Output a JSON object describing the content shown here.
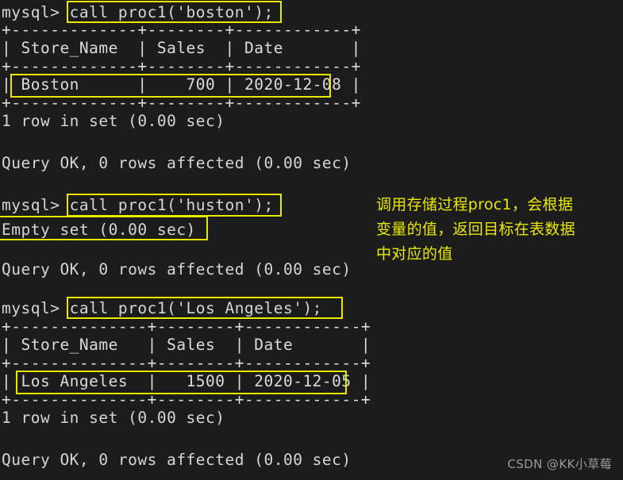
{
  "terminal": {
    "background_color": "#1c1c1c",
    "text_color": "#d6d6d6",
    "highlight_color": "#e9e900",
    "prompt": "mysql>",
    "lines": [
      {
        "text": "mysql> call proc1('boston');"
      },
      {
        "text": "+-------------+--------+------------+"
      },
      {
        "text": "| Store_Name  | Sales  | Date       |"
      },
      {
        "text": "+-------------+--------+------------+"
      },
      {
        "text": "| Boston      |    700 | 2020-12-08 |"
      },
      {
        "text": "+-------------+--------+------------+"
      },
      {
        "text": "1 row in set (0.00 sec)"
      },
      {
        "text": ""
      },
      {
        "text": "Query OK, 0 rows affected (0.00 sec)"
      },
      {
        "text": ""
      },
      {
        "text": "mysql> call proc1('huston');"
      },
      {
        "text": "Empty set (0.00 sec)"
      },
      {
        "text": ""
      },
      {
        "text": "Query OK, 0 rows affected (0.00 sec)"
      },
      {
        "text": ""
      },
      {
        "text": "mysql> call proc1('Los Angeles');"
      },
      {
        "text": "+--------------+--------+------------+"
      },
      {
        "text": "| Store_Name   | Sales  | Date       |"
      },
      {
        "text": "+--------------+--------+------------+"
      },
      {
        "text": "| Los Angeles  |   1500 | 2020-12-05 |"
      },
      {
        "text": "+--------------+--------+------------+"
      },
      {
        "text": "1 row in set (0.00 sec)"
      },
      {
        "text": ""
      },
      {
        "text": "Query OK, 0 rows affected (0.00 sec)"
      }
    ],
    "commands": [
      "call proc1('boston');",
      "call proc1('huston');",
      "call proc1('Los Angeles');"
    ],
    "result_sets": [
      {
        "columns": [
          "Store_Name",
          "Sales",
          "Date"
        ],
        "rows": [
          [
            "Boston",
            "700",
            "2020-12-08"
          ]
        ],
        "status": "1 row in set (0.00 sec)"
      },
      {
        "columns": [],
        "rows": [],
        "status": "Empty set (0.00 sec)"
      },
      {
        "columns": [
          "Store_Name",
          "Sales",
          "Date"
        ],
        "rows": [
          [
            "Los Angeles",
            "1500",
            "2020-12-05"
          ]
        ],
        "status": "1 row in set (0.00 sec)"
      }
    ],
    "query_status": "Query OK, 0 rows affected (0.00 sec)"
  },
  "annotation": {
    "text": "调用存储过程proc1，会根据\n变量的值，返回目标在表数据\n中对应的值",
    "color": "#e9e900"
  },
  "watermark": {
    "text": "CSDN @KK小草莓",
    "color": "#9a9a9a"
  }
}
